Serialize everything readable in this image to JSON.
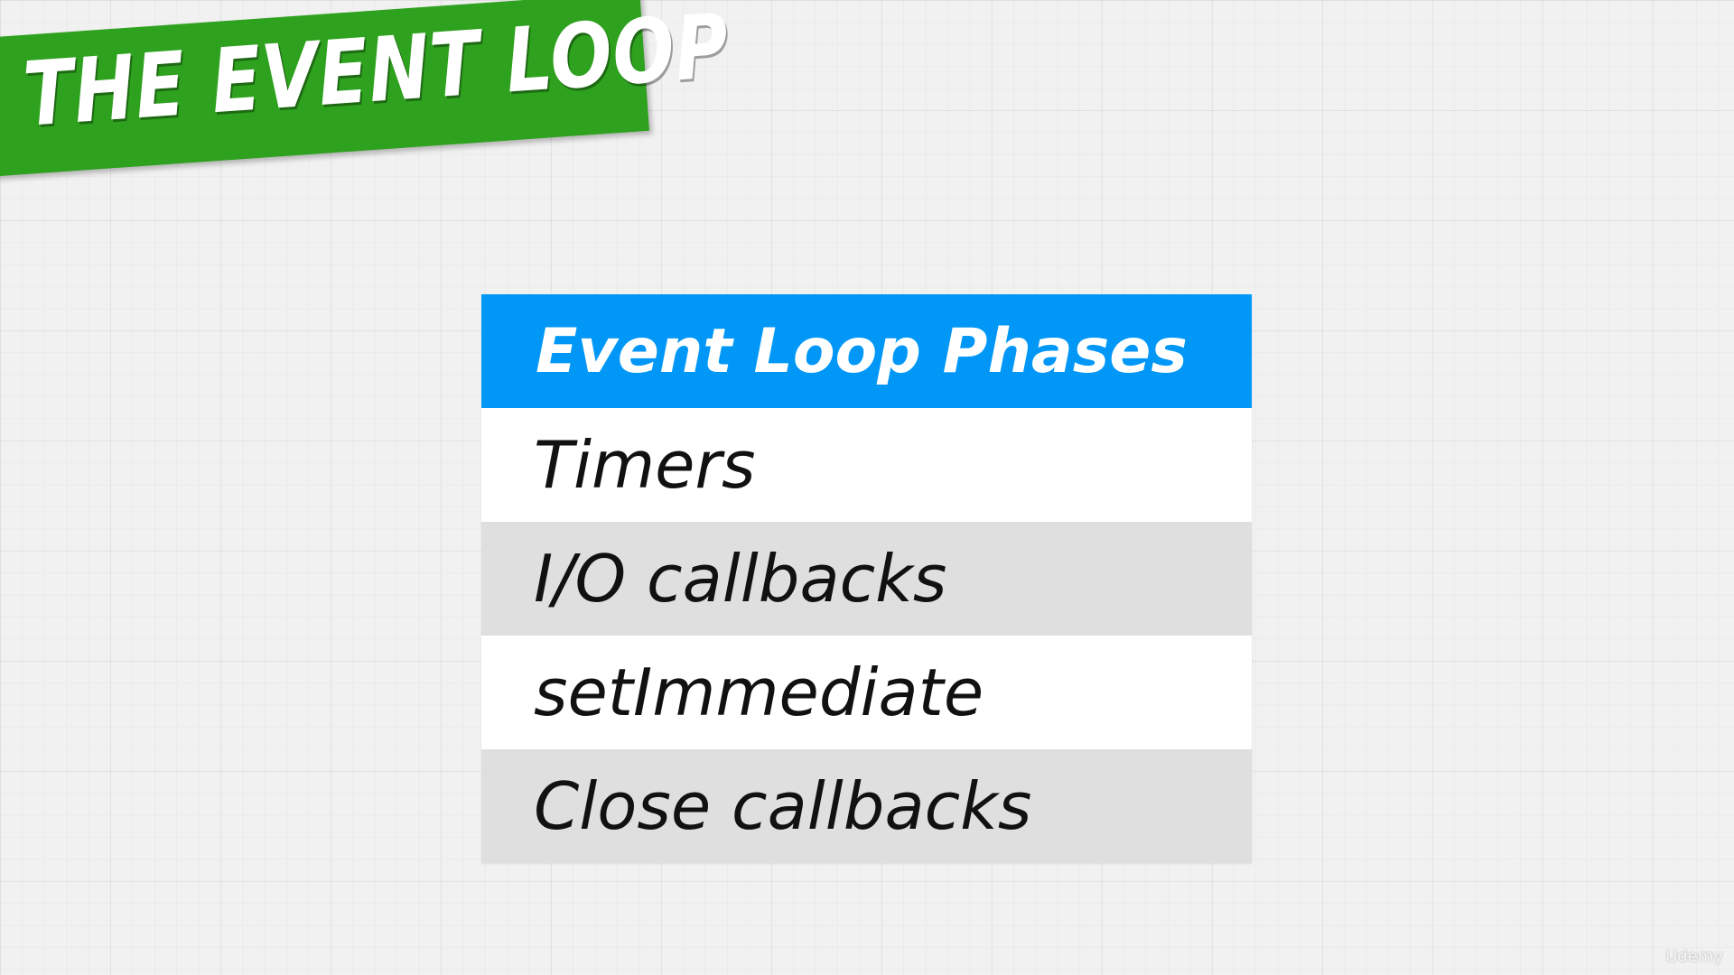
{
  "title": "THE EVENT LOOP",
  "table": {
    "header": "Event Loop Phases",
    "rows": [
      "Timers",
      "I/O callbacks",
      "setImmediate",
      "Close callbacks"
    ]
  },
  "watermark": "Udemy",
  "colors": {
    "banner": "#2ea11e",
    "header": "#0097f7",
    "row_light": "#ffffff",
    "row_dark": "#dfdfe0"
  }
}
